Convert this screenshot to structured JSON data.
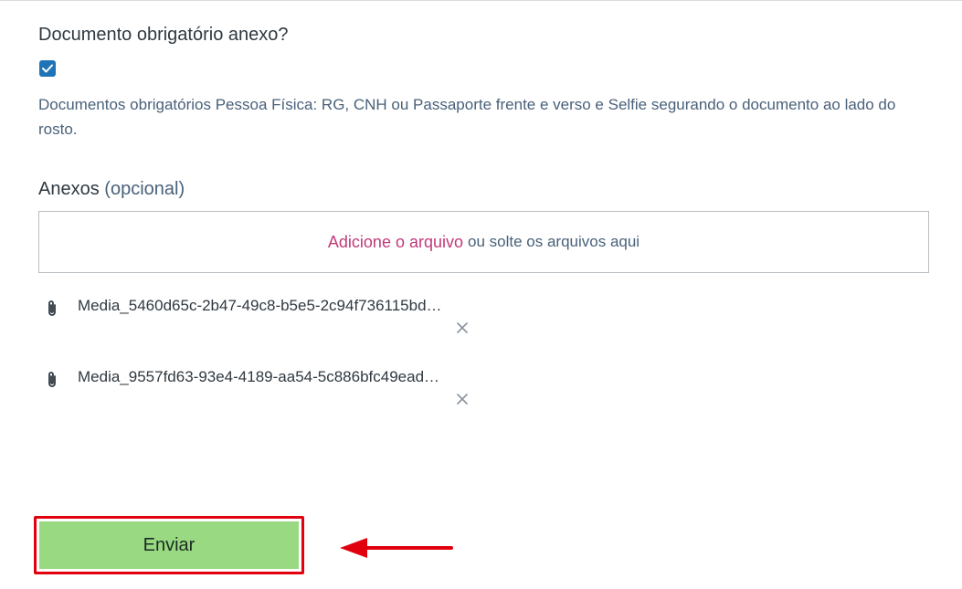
{
  "question": {
    "label": "Documento obrigatório anexo?",
    "checked": true
  },
  "hint": "Documentos obrigatórios Pessoa Física: RG, CNH ou Passaporte frente e verso e Selfie segurando o documento ao lado do rosto.",
  "attachments": {
    "label": "Anexos",
    "optional": "(opcional)",
    "dropzone_link": "Adicione o arquivo",
    "dropzone_text": "ou solte os arquivos aqui",
    "files": [
      {
        "name": "Media_5460d65c-2b47-49c8-b5e5-2c94f736115bd…"
      },
      {
        "name": "Media_9557fd63-93e4-4189-aa54-5c886bfc49ead…"
      }
    ]
  },
  "submit": {
    "label": "Enviar"
  },
  "colors": {
    "submit_bg": "#98d982",
    "highlight": "#e0000e",
    "link": "#c2397a",
    "checkbox": "#1f73b7"
  }
}
